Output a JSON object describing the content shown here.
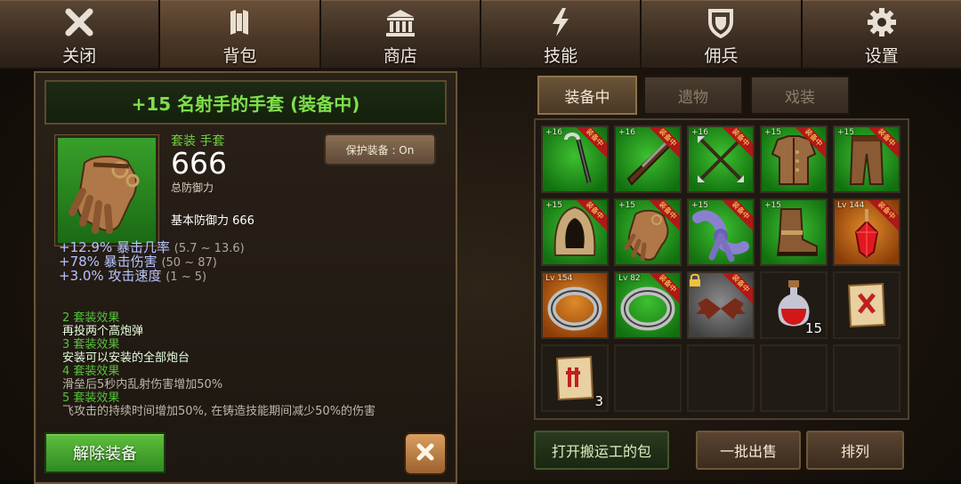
{
  "nav": {
    "tabs": [
      {
        "label": "关闭",
        "icon": "close-x-icon"
      },
      {
        "label": "背包",
        "icon": "armor-icon"
      },
      {
        "label": "商店",
        "icon": "shop-building-icon"
      },
      {
        "label": "技能",
        "icon": "lightning-icon"
      },
      {
        "label": "佣兵",
        "icon": "shield-icon"
      },
      {
        "label": "设置",
        "icon": "gear-icon"
      }
    ],
    "active": "背包"
  },
  "item": {
    "title": "+15 名射手的手套 (装备中)",
    "set_type": "套装 手套",
    "defense_value": "666",
    "defense_label": "总防御力",
    "base_defense": "基本防御力 666",
    "protect_button": "保护装备 : On"
  },
  "stats": [
    {
      "value": "+12.9% 暴击几率",
      "range": "(5.7 ~ 13.6)"
    },
    {
      "value": "+78% 暴击伤害",
      "range": "(50 ~ 87)"
    },
    {
      "value": "+3.0% 攻击速度",
      "range": "(1 ~ 5)"
    }
  ],
  "set_effects": [
    {
      "header": "2 套装效果",
      "desc": "再投两个高炮弹",
      "active": true
    },
    {
      "header": "3 套装效果",
      "desc": "安装可以安装的全部炮台",
      "active": true
    },
    {
      "header": "4 套装效果",
      "desc": "滑垒后5秒内乱射伤害增加50%",
      "active": false
    },
    {
      "header": "5 套装效果",
      "desc": "飞攻击的持续时间增加50%, 在铸造技能期间减少50%的伤害",
      "active": false
    }
  ],
  "actions": {
    "unequip": "解除装备"
  },
  "inventory_tabs": [
    "装备中",
    "遗物",
    "戏装"
  ],
  "inventory_active_tab": "装备中",
  "equipped_badge": "装备中",
  "slots": [
    {
      "level": "+16",
      "bg": "green",
      "icon": "cane-icon",
      "equipped": true
    },
    {
      "level": "+16",
      "bg": "green",
      "icon": "musket-icon",
      "equipped": true
    },
    {
      "level": "+16",
      "bg": "green",
      "icon": "crossed-arrows-icon",
      "equipped": true
    },
    {
      "level": "+15",
      "bg": "green",
      "icon": "leather-armor-icon",
      "equipped": true
    },
    {
      "level": "+15",
      "bg": "green",
      "icon": "leather-pants-icon",
      "equipped": true
    },
    {
      "level": "+15",
      "bg": "green",
      "icon": "hood-icon",
      "equipped": true
    },
    {
      "level": "+15",
      "bg": "green",
      "icon": "gloves-icon",
      "equipped": true
    },
    {
      "level": "+15",
      "bg": "green",
      "icon": "sash-icon",
      "equipped": true
    },
    {
      "level": "+15",
      "bg": "green",
      "icon": "boots-icon",
      "equipped": true
    },
    {
      "level": "Lv 144",
      "bg": "orange",
      "icon": "red-gem-icon",
      "equipped": true
    },
    {
      "level": "Lv 154",
      "bg": "orange",
      "icon": "ring-icon",
      "equipped": false
    },
    {
      "level": "Lv 82",
      "bg": "green",
      "icon": "ring-icon",
      "equipped": true
    },
    {
      "level": "",
      "bg": "gray",
      "icon": "bat-wings-icon",
      "equipped": true,
      "locked": true
    },
    {
      "level": "",
      "bg": "empty",
      "icon": "red-potion-icon",
      "equipped": false,
      "qty": "15"
    },
    {
      "level": "",
      "bg": "empty",
      "icon": "scroll-icon",
      "equipped": false
    },
    {
      "level": "",
      "bg": "empty",
      "icon": "scroll-icon",
      "equipped": false,
      "qty": "3"
    },
    {
      "level": "",
      "bg": "empty",
      "icon": "",
      "equipped": false
    },
    {
      "level": "",
      "bg": "empty",
      "icon": "",
      "equipped": false
    },
    {
      "level": "",
      "bg": "empty",
      "icon": "",
      "equipped": false
    },
    {
      "level": "",
      "bg": "empty",
      "icon": "",
      "equipped": false
    }
  ],
  "bottom_buttons": [
    "打开搬运工的包",
    "一批出售",
    "排列"
  ]
}
